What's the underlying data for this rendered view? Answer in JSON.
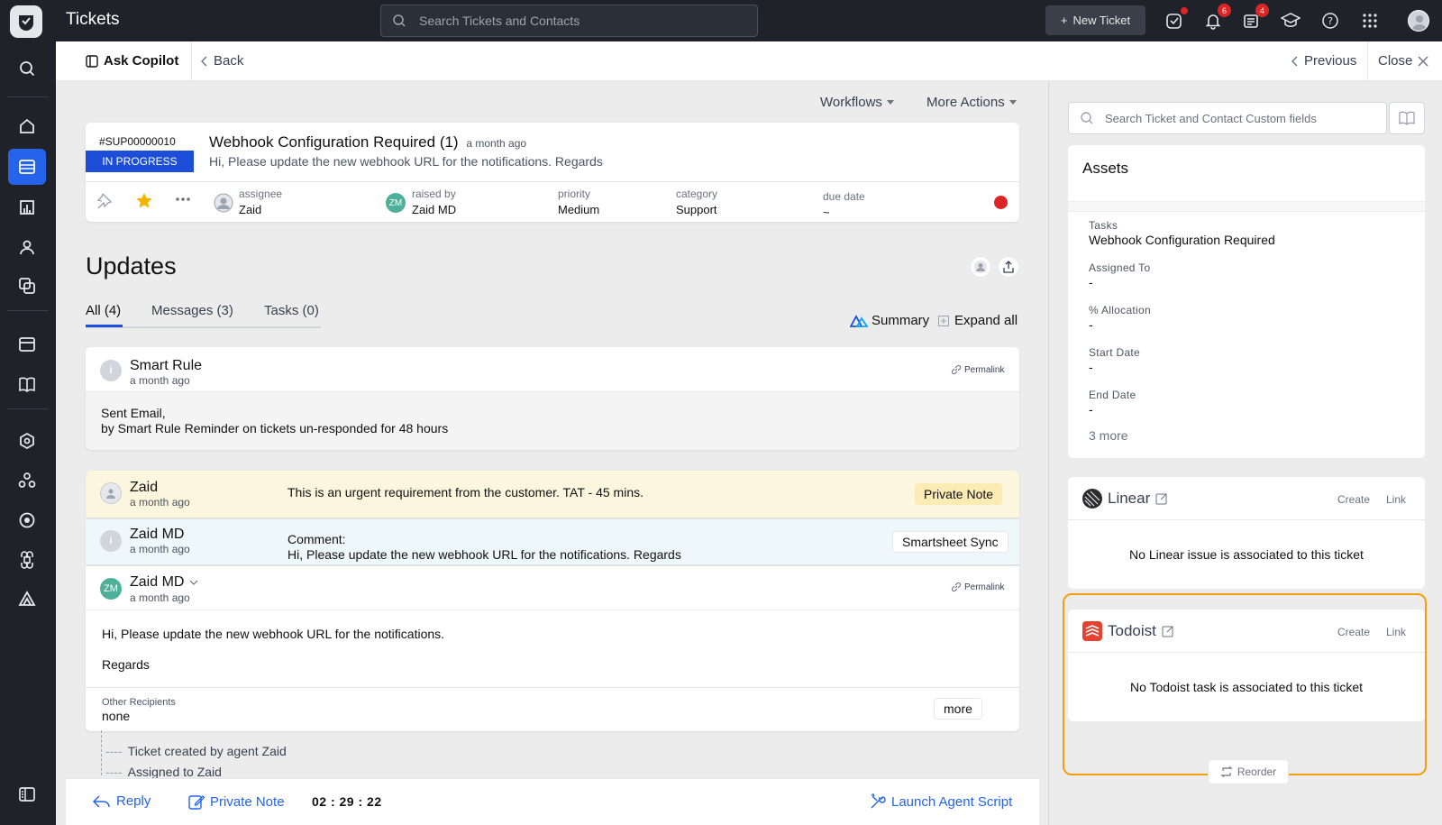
{
  "app": {
    "title": "Tickets"
  },
  "topbar": {
    "search_placeholder": "Search Tickets and Contacts",
    "new_ticket_label": "New Ticket",
    "badges": {
      "notifications": "6",
      "updates": "4"
    }
  },
  "subheader": {
    "ask_copilot": "Ask Copilot",
    "back": "Back",
    "previous": "Previous",
    "close": "Close"
  },
  "actions": {
    "workflows": "Workflows",
    "more_actions": "More Actions"
  },
  "ticket": {
    "id": "#SUP00000010",
    "status": "IN PROGRESS",
    "title": "Webhook Configuration Required",
    "count": "(1)",
    "ago": "a month ago",
    "description": "Hi, Please update the new webhook URL for the notifications. Regards",
    "meta": {
      "assignee_label": "assignee",
      "assignee": "Zaid",
      "raised_by_label": "raised by",
      "raised_by": "Zaid MD",
      "raised_by_initials": "ZM",
      "priority_label": "priority",
      "priority": "Medium",
      "category_label": "category",
      "category": "Support",
      "due_date_label": "due date",
      "due_date": "~"
    },
    "status_dot_color": "#dc2626"
  },
  "updates": {
    "title": "Updates",
    "tabs": [
      {
        "label": "All (4)"
      },
      {
        "label": "Messages (3)"
      },
      {
        "label": "Tasks (0)"
      }
    ],
    "summary_label": "Summary",
    "expand_all_label": "Expand all",
    "items": [
      {
        "name": "Smart Rule",
        "ago": "a month ago",
        "permalink": "Permalink",
        "line1": "Sent Email,",
        "line2": "by Smart Rule Reminder on tickets un-responded for 48 hours"
      },
      {
        "name": "Zaid",
        "ago": "a month ago",
        "text": "This is an urgent requirement from the customer. TAT - 45 mins.",
        "chip": "Private Note"
      },
      {
        "name": "Zaid MD",
        "ago": "a month ago",
        "text_label": "Comment:",
        "text": "Hi, Please update the new webhook URL for the notifications. Regards",
        "chip": "Smartsheet Sync"
      },
      {
        "name": "Zaid MD",
        "initials": "ZM",
        "ago": "a month ago",
        "permalink": "Permalink",
        "body1": "Hi, Please update the new webhook URL for the notifications.",
        "body2": "Regards",
        "recipients_label": "Other Recipients",
        "recipients": "none",
        "more": "more"
      }
    ],
    "timeline": [
      {
        "prefix": "----",
        "text": "Ticket created by agent Zaid"
      },
      {
        "prefix": "----",
        "text": "Assigned to Zaid"
      }
    ]
  },
  "bottom_bar": {
    "reply": "Reply",
    "private_note": "Private Note",
    "timer": "02 : 29 : 22",
    "launch_script": "Launch Agent Script"
  },
  "right_panel": {
    "search_placeholder": "Search Ticket and Contact Custom fields",
    "assets": {
      "title": "Assets",
      "fields": [
        {
          "label": "Tasks",
          "value": "Webhook Configuration Required"
        },
        {
          "label": "Assigned To",
          "value": "-"
        },
        {
          "label": "% Allocation",
          "value": "-"
        },
        {
          "label": "Start Date",
          "value": "-"
        },
        {
          "label": "End Date",
          "value": "-"
        }
      ],
      "more": "3 more"
    },
    "linear": {
      "name": "Linear",
      "create": "Create",
      "link": "Link",
      "empty": "No Linear issue is associated to this ticket"
    },
    "todoist": {
      "name": "Todoist",
      "create": "Create",
      "link": "Link",
      "empty": "No Todoist task is associated to this ticket"
    },
    "reorder": "Reorder"
  }
}
